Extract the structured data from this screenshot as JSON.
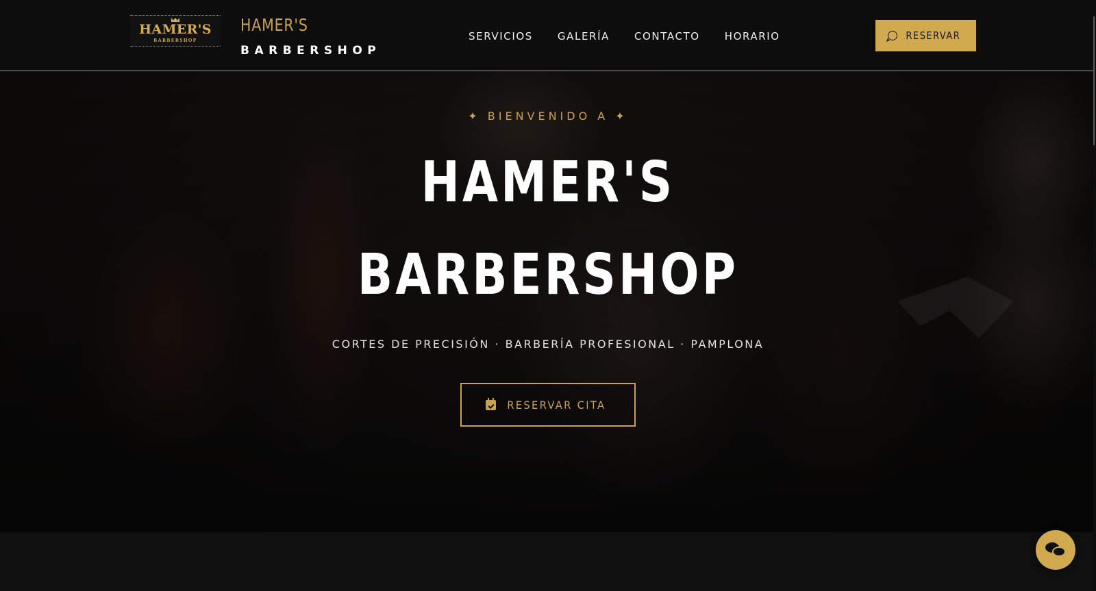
{
  "brand": {
    "logo_main": "HAMER'S",
    "logo_sub": "BARBERSHOP",
    "title": "HAMER'S",
    "subtitle": "BARBERSHOP"
  },
  "nav": {
    "items": [
      {
        "label": "SERVICIOS"
      },
      {
        "label": "GALERÍA"
      },
      {
        "label": "CONTACTO"
      },
      {
        "label": "HORARIO"
      }
    ],
    "cta_label": "RESERVAR"
  },
  "hero": {
    "eyebrow": "✦ BIENVENIDO A ✦",
    "title_line1": "HAMER'S",
    "title_line2": "BARBERSHOP",
    "tagline": "CORTES DE PRECISIÓN · BARBERÍA PROFESIONAL · PAMPLONA",
    "cta_label": "RESERVAR CITA"
  },
  "icons": {
    "header_cta_icon": "whatsapp-icon",
    "hero_cta_icon": "calendar-check-icon",
    "chat_icon": "chat-bubbles-icon"
  },
  "colors": {
    "accent_gold": "#d1a94f",
    "background": "#0f0f0f",
    "text": "#ffffff"
  }
}
